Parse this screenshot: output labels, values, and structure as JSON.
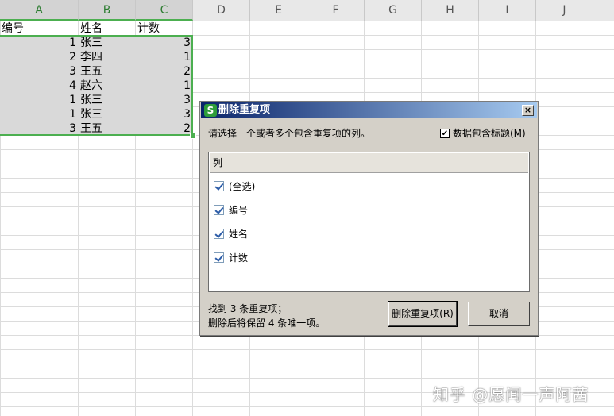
{
  "sheet": {
    "columns": [
      "A",
      "B",
      "C",
      "D",
      "E",
      "F",
      "G",
      "H",
      "I",
      "J"
    ],
    "header_row": [
      "编号",
      "姓名",
      "计数"
    ],
    "rows": [
      {
        "id": "1",
        "name": "张三",
        "count": "3"
      },
      {
        "id": "2",
        "name": "李四",
        "count": "1"
      },
      {
        "id": "3",
        "name": "王五",
        "count": "2"
      },
      {
        "id": "4",
        "name": "赵六",
        "count": "1"
      },
      {
        "id": "1",
        "name": "张三",
        "count": "3"
      },
      {
        "id": "1",
        "name": "张三",
        "count": "3"
      },
      {
        "id": "3",
        "name": "王五",
        "count": "2"
      }
    ]
  },
  "dialog": {
    "title": "删除重复项",
    "icon_letter": "S",
    "close_glyph": "×",
    "instruction": "请选择一个或者多个包含重复项的列。",
    "header_checkbox_label": "数据包含标题(M)",
    "header_checkbox_checked": true,
    "list_header": "列",
    "list_items": [
      {
        "label": "(全选)",
        "checked": true
      },
      {
        "label": "编号",
        "checked": true
      },
      {
        "label": "姓名",
        "checked": true
      },
      {
        "label": "计数",
        "checked": true
      }
    ],
    "status_line1": "找到 3 条重复项；",
    "status_line2": "删除后将保留 4 条唯一项。",
    "remove_button": "删除重复项(R)",
    "cancel_button": "取消"
  },
  "watermark": "知乎 @愿闻一声阿茜"
}
